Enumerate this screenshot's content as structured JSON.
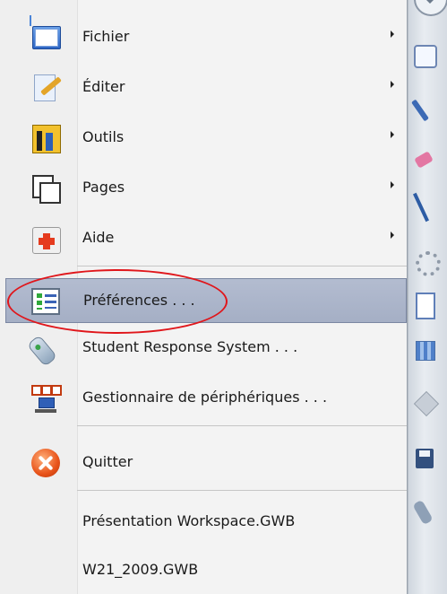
{
  "menu": {
    "items": [
      {
        "label": "Fichier",
        "icon": "folder-icon",
        "submenu": true
      },
      {
        "label": "Éditer",
        "icon": "edit-icon",
        "submenu": true
      },
      {
        "label": "Outils",
        "icon": "tools-icon",
        "submenu": true
      },
      {
        "label": "Pages",
        "icon": "pages-icon",
        "submenu": true
      },
      {
        "label": "Aide",
        "icon": "help-icon",
        "submenu": true
      },
      {
        "label": "Préférences . . .",
        "icon": "preferences-icon",
        "highlighted": true
      },
      {
        "label": "Student Response System . . .",
        "icon": "remote-icon"
      },
      {
        "label": "Gestionnaire de périphériques . . .",
        "icon": "device-manager-icon"
      },
      {
        "label": "Quitter",
        "icon": "quit-icon"
      }
    ],
    "recent_files": [
      {
        "label": "Présentation Workspace.GWB"
      },
      {
        "label": "W21_2009.GWB"
      }
    ]
  },
  "colors": {
    "highlight": "#a9b3c8",
    "annotation": "#e0161b",
    "menu_background": "#f3f3f3"
  }
}
